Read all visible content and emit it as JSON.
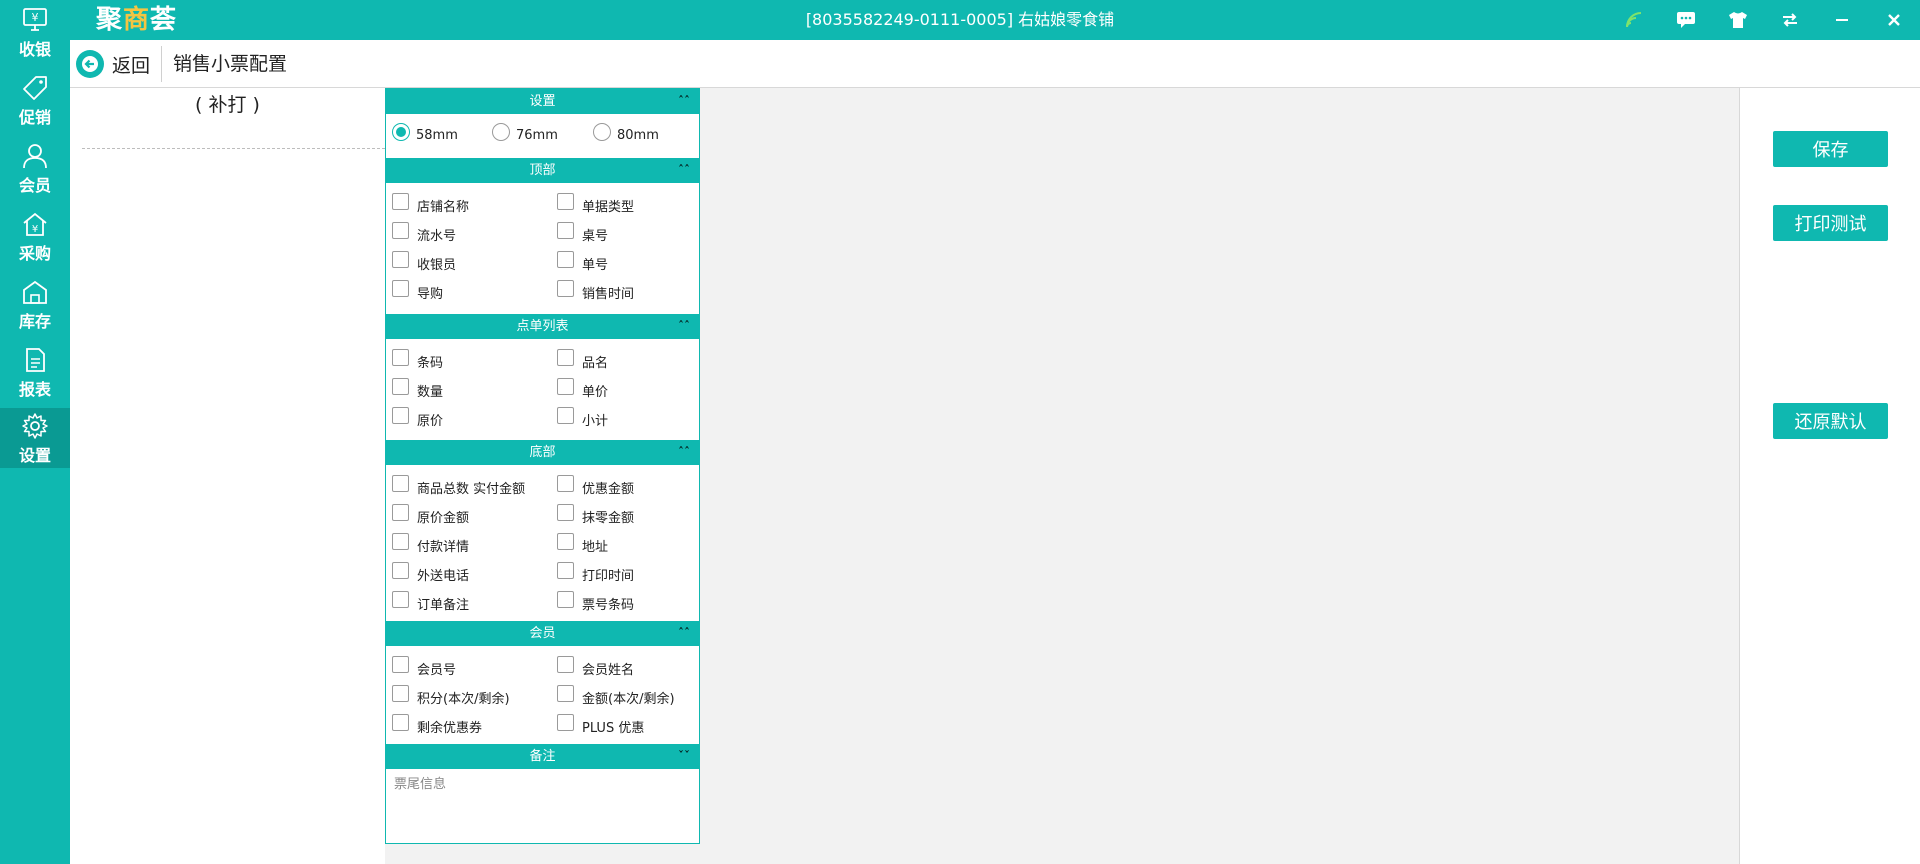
{
  "app": {
    "logo": {
      "pre": "聚",
      "mid": "商",
      "post": "荟"
    },
    "window_title": "[8035582249-0111-0005] 右姑娘零食铺",
    "titlebar_icons": [
      "wifi-icon",
      "message-icon",
      "shirt-icon",
      "switch-icon",
      "minimize-icon",
      "close-icon"
    ],
    "accent_color": "#0fb8b0"
  },
  "sidebar": {
    "items": [
      {
        "label": "收银",
        "icon": "cashier-icon"
      },
      {
        "label": "促销",
        "icon": "tag-icon"
      },
      {
        "label": "会员",
        "icon": "user-icon"
      },
      {
        "label": "采购",
        "icon": "purchase-icon"
      },
      {
        "label": "库存",
        "icon": "warehouse-icon"
      },
      {
        "label": "报表",
        "icon": "report-icon"
      },
      {
        "label": "设置",
        "icon": "gear-icon",
        "active": true
      }
    ]
  },
  "header": {
    "back_label": "返回",
    "title": "销售小票配置"
  },
  "preview": {
    "reprint_label": "( 补打 )"
  },
  "settings": {
    "paper": {
      "title": "设置",
      "options": [
        "58mm",
        "76mm",
        "80mm"
      ],
      "selected": "58mm"
    },
    "top": {
      "title": "顶部",
      "items": [
        "店铺名称",
        "单据类型",
        "流水号",
        "桌号",
        "收银员",
        "单号",
        "导购",
        "销售时间"
      ]
    },
    "list": {
      "title": "点单列表",
      "items": [
        "条码",
        "品名",
        "数量",
        "单价",
        "原价",
        "小计"
      ]
    },
    "bottom": {
      "title": "底部",
      "items": [
        "商品总数 实付金额",
        "优惠金额",
        "原价金额",
        "抹零金额",
        "付款详情",
        "地址",
        "外送电话",
        "打印时间",
        "订单备注",
        "票号条码"
      ]
    },
    "member": {
      "title": "会员",
      "items": [
        "会员号",
        "会员姓名",
        "积分(本次/剩余)",
        "金额(本次/剩余)",
        "剩余优惠券",
        "PLUS 优惠"
      ]
    },
    "remark": {
      "title": "备注",
      "placeholder": "票尾信息"
    }
  },
  "actions": {
    "save": "保存",
    "print_test": "打印测试",
    "restore_default": "还原默认"
  }
}
